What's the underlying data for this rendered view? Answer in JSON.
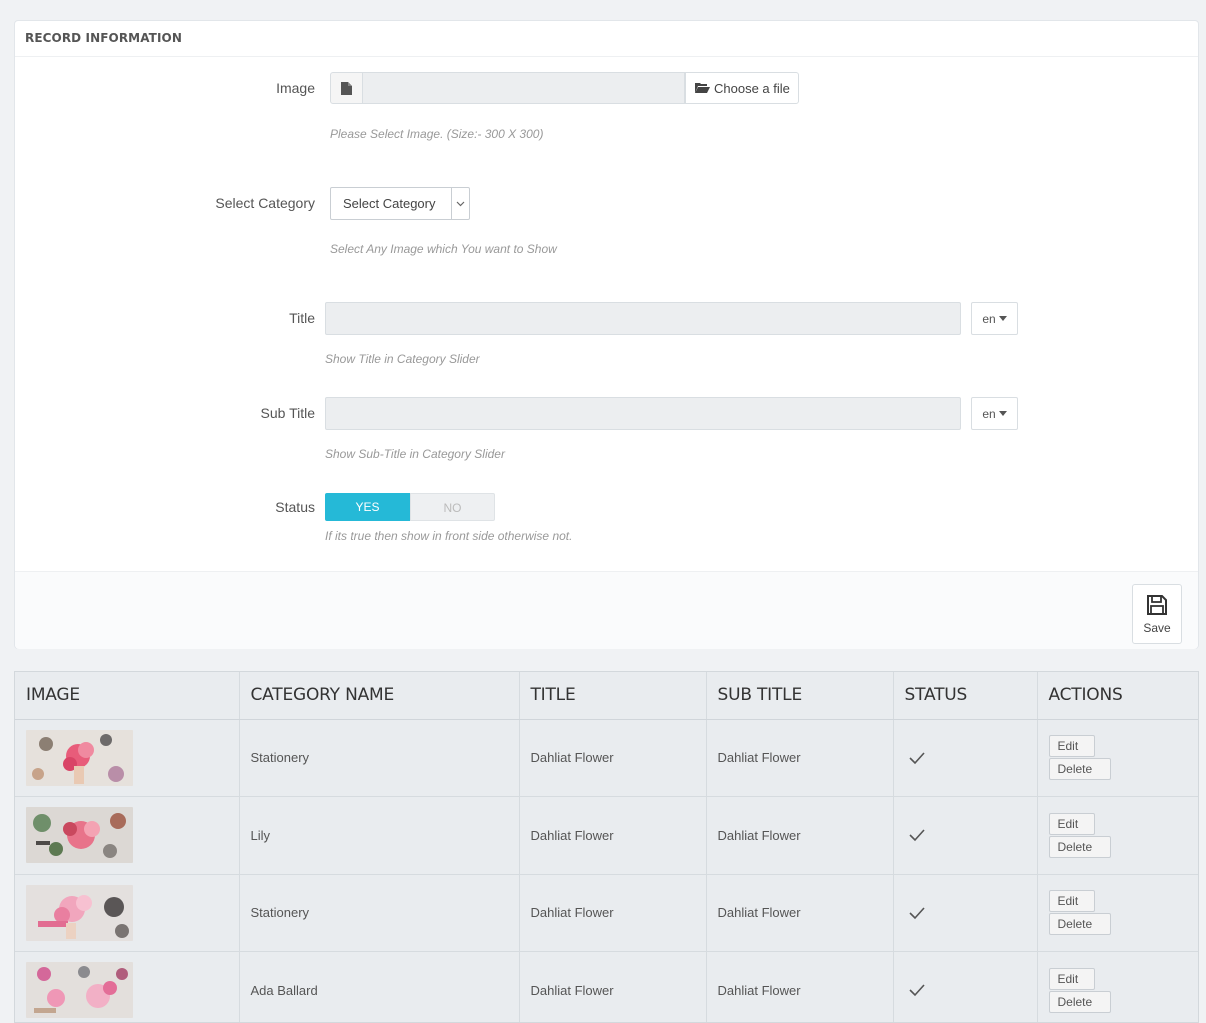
{
  "form": {
    "heading": "RECORD INFORMATION",
    "image": {
      "label": "Image",
      "button_label": "Choose a file",
      "help": "Please Select Image. (Size:- 300 X 300)"
    },
    "category": {
      "label": "Select Category",
      "selected": "Select Category",
      "help": "Select Any Image which You want to Show"
    },
    "title": {
      "label": "Title",
      "value": "",
      "lang": "en",
      "help": "Show Title in Category Slider"
    },
    "subtitle": {
      "label": "Sub Title",
      "value": "",
      "lang": "en",
      "help": "Show Sub-Title in Category Slider"
    },
    "status": {
      "label": "Status",
      "yes_label": "YES",
      "no_label": "NO",
      "selected": "YES",
      "help": "If its true then show in front side otherwise not."
    },
    "save_label": "Save"
  },
  "table": {
    "columns": [
      "IMAGE",
      "CATEGORY NAME",
      "TITLE",
      "SUB TITLE",
      "STATUS",
      "ACTIONS"
    ],
    "rows": [
      {
        "category": "Stationery",
        "title": "Dahliat Flower",
        "subtitle": "Dahliat Flower",
        "status": "active",
        "edit": "Edit",
        "delete": "Delete"
      },
      {
        "category": "Lily",
        "title": "Dahliat Flower",
        "subtitle": "Dahliat Flower",
        "status": "active",
        "edit": "Edit",
        "delete": "Delete"
      },
      {
        "category": "Stationery",
        "title": "Dahliat Flower",
        "subtitle": "Dahliat Flower",
        "status": "active",
        "edit": "Edit",
        "delete": "Delete"
      },
      {
        "category": "Ada Ballard",
        "title": "Dahliat Flower",
        "subtitle": "Dahliat Flower",
        "status": "active",
        "edit": "Edit",
        "delete": "Delete"
      }
    ]
  },
  "colors": {
    "accent": "#25b9d7",
    "page_background": "#f0f2f4",
    "table_background": "#e9ecef"
  },
  "icons": {
    "file": "file-icon",
    "folder": "folder-open-icon",
    "save": "floppy-disk-icon",
    "status": "check-icon"
  }
}
